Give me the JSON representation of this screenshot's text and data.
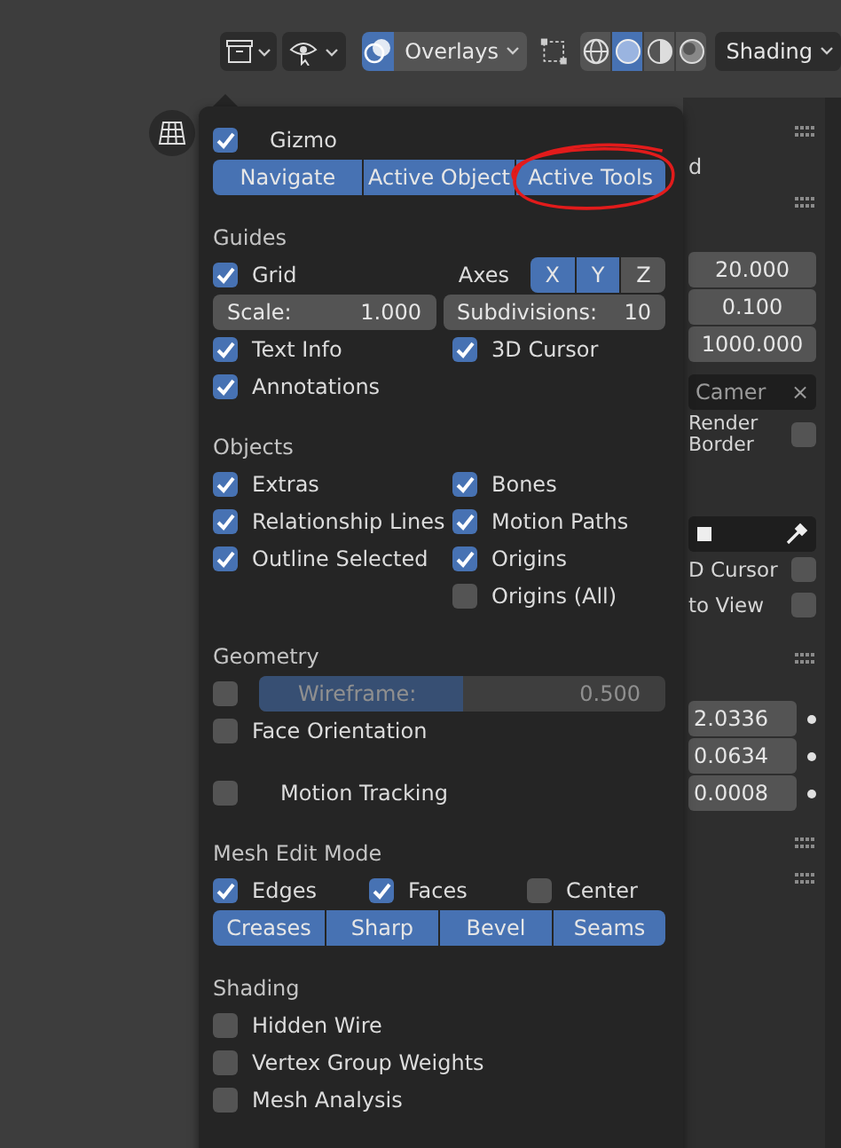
{
  "header": {
    "overlays_enabled": true,
    "overlays_label": "Overlays",
    "shading_modes": [
      {
        "selected": false
      },
      {
        "selected": true
      },
      {
        "selected": false
      },
      {
        "selected": false
      }
    ],
    "shading_label": "Shading"
  },
  "popover": {
    "rows": [
      {
        "kind": "checks",
        "items": [
          {
            "label": "Gizmo",
            "checked": true
          }
        ]
      },
      {
        "kind": "segments",
        "items": [
          {
            "label": "Navigate",
            "selected": true
          },
          {
            "label": "Active Object",
            "selected": true
          },
          {
            "label": "Active Tools",
            "selected": true,
            "circled": true
          }
        ]
      },
      {
        "kind": "heading",
        "label": "Guides"
      },
      {
        "kind": "grid_axes",
        "check": {
          "label": "Grid",
          "checked": true
        },
        "axes_label": "Axes",
        "axes": [
          {
            "label": "X",
            "selected": true
          },
          {
            "label": "Y",
            "selected": true
          },
          {
            "label": "Z",
            "selected": false
          }
        ]
      },
      {
        "kind": "fields",
        "items": [
          {
            "label": "Scale:",
            "value": "1.000"
          },
          {
            "label": "Subdivisions:",
            "value": "10"
          }
        ]
      },
      {
        "kind": "checks",
        "items": [
          {
            "label": "Text Info",
            "checked": true
          },
          {
            "label": "3D Cursor",
            "checked": true
          }
        ]
      },
      {
        "kind": "checks",
        "items": [
          {
            "label": "Annotations",
            "checked": true
          }
        ]
      },
      {
        "kind": "heading",
        "label": "Objects"
      },
      {
        "kind": "checks",
        "items": [
          {
            "label": "Extras",
            "checked": true
          },
          {
            "label": "Bones",
            "checked": true
          }
        ]
      },
      {
        "kind": "checks",
        "items": [
          {
            "label": "Relationship Lines",
            "checked": true
          },
          {
            "label": "Motion Paths",
            "checked": true
          }
        ]
      },
      {
        "kind": "checks",
        "items": [
          {
            "label": "Outline Selected",
            "checked": true
          },
          {
            "label": "Origins",
            "checked": true
          }
        ]
      },
      {
        "kind": "checks",
        "empty_left": true,
        "items": [
          {
            "label": "Origins (All)",
            "checked": false
          }
        ]
      },
      {
        "kind": "heading",
        "label": "Geometry"
      },
      {
        "kind": "check_slider",
        "checked": false,
        "label": "Wireframe:",
        "value": "0.500",
        "level": 0.5
      },
      {
        "kind": "checks",
        "items": [
          {
            "label": "Face Orientation",
            "checked": false
          }
        ]
      },
      {
        "kind": "checks",
        "indent": true,
        "items": [
          {
            "label": "Motion Tracking",
            "checked": false
          }
        ]
      },
      {
        "kind": "heading",
        "label": "Mesh Edit Mode"
      },
      {
        "kind": "checks",
        "items": [
          {
            "label": "Edges",
            "checked": true
          },
          {
            "label": "Faces",
            "checked": true
          },
          {
            "label": "Center",
            "checked": false
          }
        ]
      },
      {
        "kind": "segments",
        "items": [
          {
            "label": "Creases",
            "selected": true
          },
          {
            "label": "Sharp",
            "selected": true
          },
          {
            "label": "Bevel",
            "selected": true
          },
          {
            "label": "Seams",
            "selected": true
          }
        ]
      },
      {
        "kind": "heading",
        "label": "Shading"
      },
      {
        "kind": "checks",
        "items": [
          {
            "label": "Hidden Wire",
            "checked": false
          }
        ]
      },
      {
        "kind": "checks",
        "items": [
          {
            "label": "Vertex Group Weights",
            "checked": false
          }
        ]
      },
      {
        "kind": "checks",
        "items": [
          {
            "label": "Mesh Analysis",
            "checked": false
          }
        ]
      }
    ]
  },
  "side_panel": {
    "name_tail": "d",
    "view_values": [
      "20.000",
      "0.100",
      "1000.000"
    ],
    "camera_field": "Camer",
    "clear_symbol": "×",
    "render_border": {
      "label": "Render Border",
      "checked": false
    },
    "lock_rows": [
      {
        "label": "D Cursor",
        "checked": false
      },
      {
        "label": "to View",
        "checked": false
      }
    ],
    "cursor_values": [
      "2.0336",
      "0.0634",
      "0.0008"
    ]
  }
}
